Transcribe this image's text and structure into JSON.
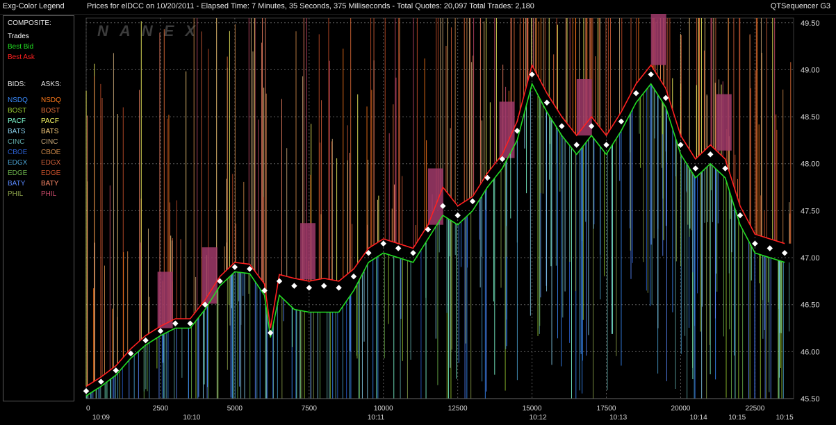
{
  "window": {
    "legend_title": "Exg-Color Legend",
    "title": "Prices for  elDCC  on  10/20/2011  -  Elapsed Time: 7 Minutes, 35 Seconds, 375 Milliseconds  -  Total Quotes: 20,097  Total Trades: 2,180",
    "app_name": "QTSequencer G3"
  },
  "legend": {
    "composite_header": "COMPOSITE:",
    "composite": [
      {
        "label": "Trades",
        "color": "#ffffff"
      },
      {
        "label": "Best Bid",
        "color": "#22dd22"
      },
      {
        "label": "Best Ask",
        "color": "#ff2020"
      }
    ],
    "bids_header": "BIDS:",
    "asks_header": "ASKS:",
    "exchanges": [
      {
        "bid": "NSDQ",
        "ask": "NSDQ",
        "bid_color": "#3a8cff",
        "ask_color": "#ff7a1a"
      },
      {
        "bid": "BOST",
        "ask": "BOST",
        "bid_color": "#9acd32",
        "ask_color": "#e8703a"
      },
      {
        "bid": "PACF",
        "ask": "PACF",
        "bid_color": "#7fffd4",
        "ask_color": "#ffff66"
      },
      {
        "bid": "BATS",
        "ask": "BATS",
        "bid_color": "#87ceeb",
        "ask_color": "#ffd27f"
      },
      {
        "bid": "CINC",
        "ask": "CINC",
        "bid_color": "#5fa8a8",
        "ask_color": "#c8a878"
      },
      {
        "bid": "CBOE",
        "ask": "CBOE",
        "bid_color": "#2a5fd0",
        "ask_color": "#d08a4a"
      },
      {
        "bid": "EDGX",
        "ask": "EDGX",
        "bid_color": "#4aa0d0",
        "ask_color": "#d0603a"
      },
      {
        "bid": "EDGE",
        "ask": "EDGE",
        "bid_color": "#6ab04a",
        "ask_color": "#c8502a"
      },
      {
        "bid": "BATY",
        "ask": "BATY",
        "bid_color": "#5a8aff",
        "ask_color": "#ff8a6a"
      },
      {
        "bid": "PHIL",
        "ask": "PHIL",
        "bid_color": "#8aa04a",
        "ask_color": "#c84a6a"
      }
    ]
  },
  "chart_data": {
    "type": "line",
    "watermark": "NANEX",
    "xlim": [
      0,
      23800
    ],
    "ylim": [
      45.5,
      49.55
    ],
    "x_ticks": [
      0,
      2500,
      5000,
      7500,
      10000,
      12500,
      15000,
      17500,
      20000,
      22500
    ],
    "x_tick_labels": [
      "0",
      "2500",
      "5000",
      "7500",
      "10000",
      "12500",
      "15000",
      "17500",
      "20000",
      "22500"
    ],
    "time_ticks": [
      {
        "x": 500,
        "label": "10:09"
      },
      {
        "x": 3550,
        "label": "10:10"
      },
      {
        "x": 9750,
        "label": "10:11"
      },
      {
        "x": 15200,
        "label": "10:12"
      },
      {
        "x": 17900,
        "label": "10:13"
      },
      {
        "x": 20600,
        "label": "10:14"
      },
      {
        "x": 21900,
        "label": "10:15"
      },
      {
        "x": 23500,
        "label": "10:15"
      }
    ],
    "y_ticks": [
      45.5,
      46.0,
      46.5,
      47.0,
      47.5,
      48.0,
      48.5,
      49.0,
      49.5
    ],
    "y_tick_labels": [
      "45.50",
      "46.00",
      "46.50",
      "47.00",
      "47.50",
      "48.00",
      "48.50",
      "49.00",
      "49.50"
    ],
    "grid": true,
    "trades": {
      "name": "Trades",
      "color": "#ffffff",
      "x": [
        0,
        500,
        1000,
        1500,
        2000,
        2500,
        3000,
        3500,
        4000,
        4500,
        5000,
        5500,
        6000,
        6200,
        6500,
        7000,
        7500,
        8000,
        8500,
        9000,
        9500,
        10000,
        10500,
        11000,
        11500,
        12000,
        12500,
        13000,
        13500,
        14000,
        14500,
        15000,
        15500,
        16000,
        16500,
        17000,
        17500,
        18000,
        18500,
        19000,
        19500,
        20000,
        20500,
        21000,
        21500,
        22000,
        22500,
        23000,
        23500
      ],
      "y": [
        45.58,
        45.68,
        45.8,
        45.98,
        46.12,
        46.22,
        46.3,
        46.3,
        46.5,
        46.75,
        46.9,
        46.88,
        46.65,
        46.2,
        46.75,
        46.7,
        46.68,
        46.7,
        46.68,
        46.8,
        47.05,
        47.15,
        47.1,
        47.05,
        47.3,
        47.55,
        47.45,
        47.6,
        47.85,
        48.05,
        48.35,
        48.95,
        48.65,
        48.4,
        48.2,
        48.4,
        48.2,
        48.45,
        48.75,
        48.95,
        48.7,
        48.2,
        47.95,
        48.1,
        47.95,
        47.45,
        47.15,
        47.1,
        47.05
      ]
    },
    "best_bid": {
      "name": "Best Bid",
      "color": "#22dd22",
      "x": [
        0,
        500,
        1000,
        1500,
        2000,
        2500,
        3000,
        3500,
        4000,
        4500,
        5000,
        5500,
        6000,
        6200,
        6500,
        7000,
        7500,
        8000,
        8500,
        9000,
        9500,
        10000,
        10500,
        11000,
        11500,
        12000,
        12500,
        13000,
        13500,
        14000,
        14500,
        15000,
        15500,
        16000,
        16500,
        17000,
        17500,
        18000,
        18500,
        19000,
        19500,
        20000,
        20500,
        21000,
        21500,
        22000,
        22500,
        23000,
        23500
      ],
      "y": [
        45.53,
        45.63,
        45.75,
        45.93,
        46.07,
        46.17,
        46.25,
        46.25,
        46.45,
        46.7,
        46.85,
        46.83,
        46.6,
        46.15,
        46.6,
        46.45,
        46.42,
        46.42,
        46.42,
        46.65,
        46.95,
        47.05,
        47.0,
        46.95,
        47.2,
        47.45,
        47.35,
        47.5,
        47.75,
        47.95,
        48.25,
        48.85,
        48.55,
        48.3,
        48.1,
        48.3,
        48.1,
        48.35,
        48.65,
        48.85,
        48.6,
        48.1,
        47.85,
        48.0,
        47.85,
        47.35,
        47.05,
        47.0,
        46.95
      ]
    },
    "best_ask": {
      "name": "Best Ask",
      "color": "#ff2020",
      "x": [
        0,
        500,
        1000,
        1500,
        2000,
        2500,
        3000,
        3500,
        4000,
        4500,
        5000,
        5500,
        6000,
        6200,
        6500,
        7000,
        7500,
        8000,
        8500,
        9000,
        9500,
        10000,
        10500,
        11000,
        11500,
        12000,
        12500,
        13000,
        13500,
        14000,
        14500,
        15000,
        15500,
        16000,
        16500,
        17000,
        17500,
        18000,
        18500,
        19000,
        19500,
        20000,
        20500,
        21000,
        21500,
        22000,
        22500,
        23000,
        23500
      ],
      "y": [
        45.63,
        45.73,
        45.85,
        46.03,
        46.17,
        46.27,
        46.35,
        46.35,
        46.55,
        46.8,
        46.95,
        46.93,
        46.72,
        46.25,
        46.82,
        46.78,
        46.75,
        46.78,
        46.75,
        46.88,
        47.1,
        47.2,
        47.15,
        47.1,
        47.35,
        47.75,
        47.55,
        47.65,
        47.9,
        48.1,
        48.45,
        49.05,
        48.75,
        48.5,
        48.3,
        48.5,
        48.3,
        48.55,
        48.85,
        49.05,
        48.8,
        48.3,
        48.05,
        48.2,
        48.05,
        47.55,
        47.25,
        47.2,
        47.15
      ]
    }
  }
}
